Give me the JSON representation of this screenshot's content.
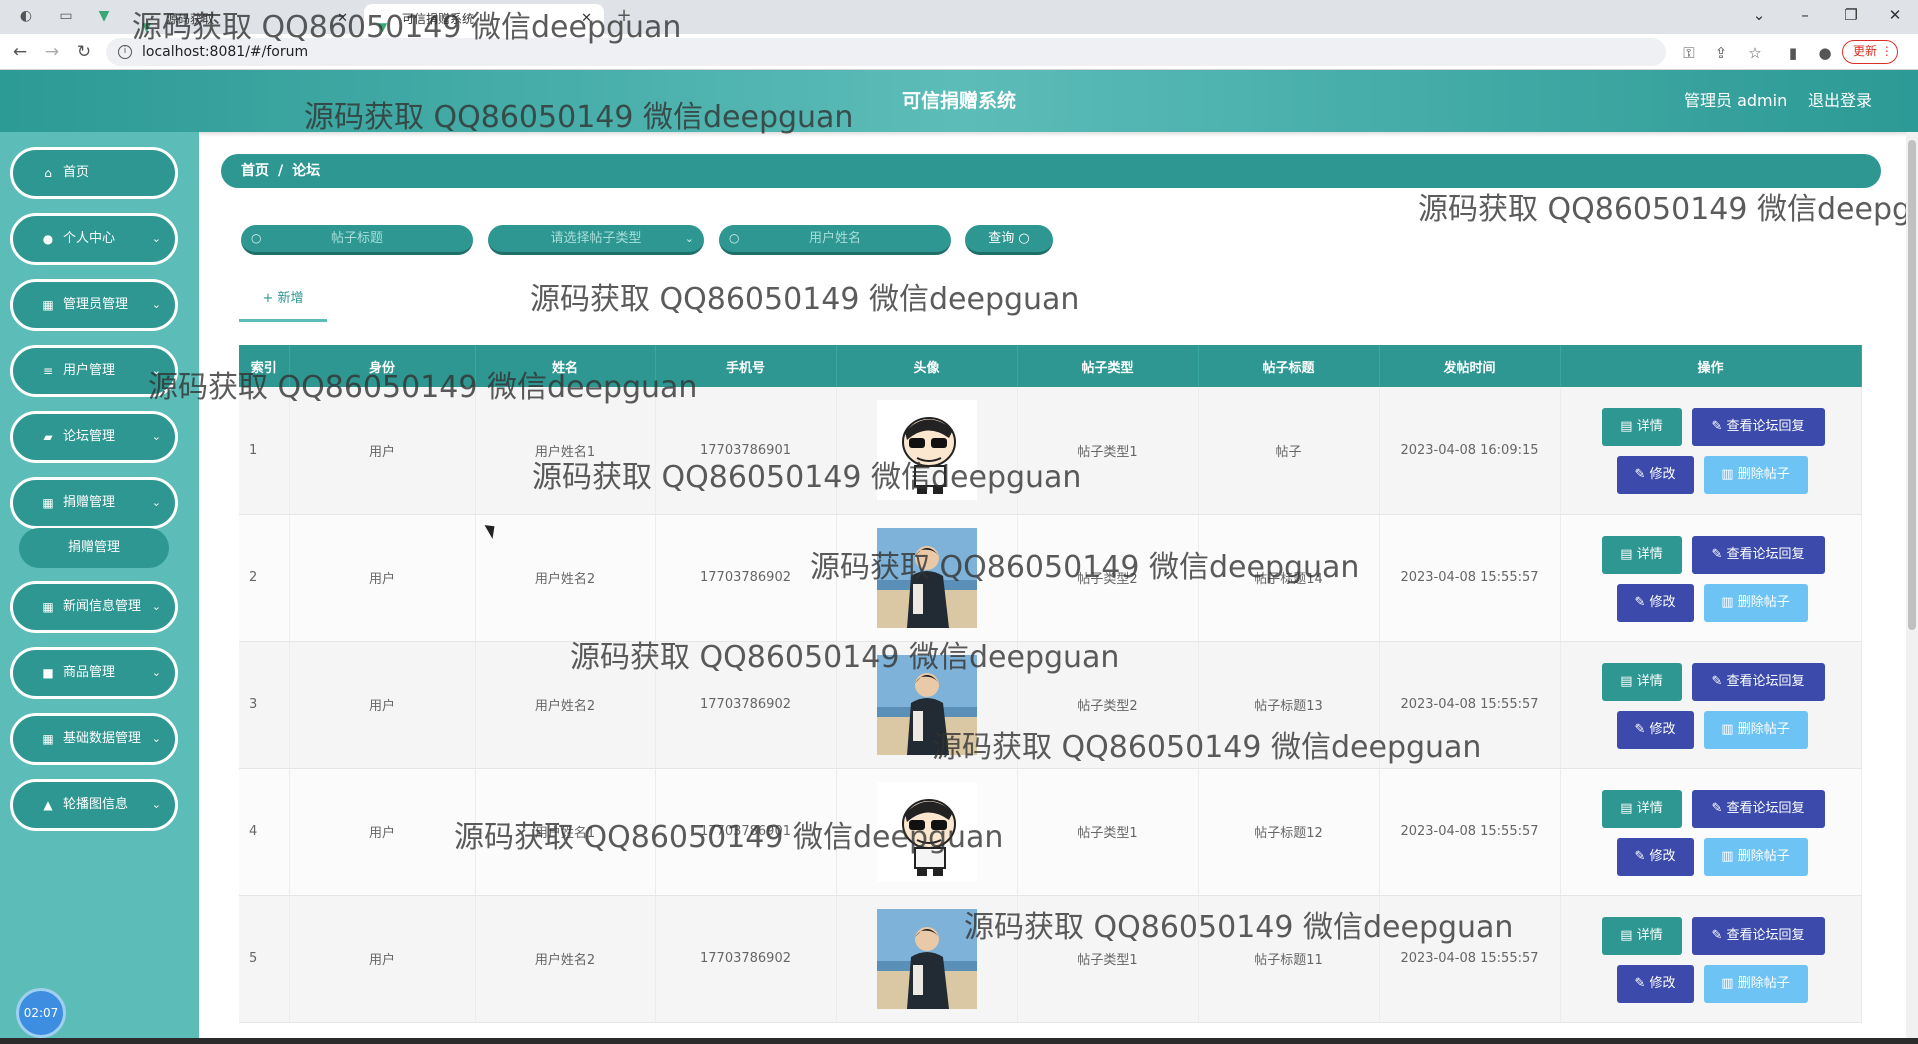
{
  "browser": {
    "tabs": [
      {
        "title": "源码获取"
      },
      {
        "title": "可信捐赠系统"
      }
    ],
    "url": "localhost:8081/#/forum",
    "update_label": "更新"
  },
  "header": {
    "title": "可信捐赠系统",
    "admin": "管理员 admin",
    "logout": "退出登录"
  },
  "sidebar": {
    "items": [
      {
        "label": "首页",
        "icon": "home-icon",
        "expandable": false
      },
      {
        "label": "个人中心",
        "icon": "user-icon",
        "expandable": true
      },
      {
        "label": "管理员管理",
        "icon": "grid-icon",
        "expandable": true
      },
      {
        "label": "用户管理",
        "icon": "list-icon",
        "expandable": true
      },
      {
        "label": "论坛管理",
        "icon": "chat-icon",
        "expandable": true
      },
      {
        "label": "捐赠管理",
        "icon": "grid-icon",
        "expandable": true
      },
      {
        "label": "新闻信息管理",
        "icon": "grid-icon",
        "expandable": true
      },
      {
        "label": "商品管理",
        "icon": "bag-icon",
        "expandable": true
      },
      {
        "label": "基础数据管理",
        "icon": "grid-icon",
        "expandable": true
      },
      {
        "label": "轮播图信息",
        "icon": "person-icon",
        "expandable": true
      }
    ],
    "sub_item": "捐赠管理",
    "clock": "02:07"
  },
  "breadcrumb": {
    "home": "首页",
    "separator": "/",
    "current": "论坛"
  },
  "search": {
    "title_placeholder": "帖子标题",
    "type_placeholder": "请选择帖子类型",
    "user_placeholder": "用户姓名",
    "query_label": "查询"
  },
  "add_label": "+ 新增",
  "table": {
    "columns": [
      "索引",
      "身份",
      "姓名",
      "手机号",
      "头像",
      "帖子类型",
      "帖子标题",
      "发帖时间",
      "操作"
    ],
    "rows": [
      {
        "index": "1",
        "role": "用户",
        "name": "用户姓名1",
        "phone": "17703786901",
        "avatar": "cartoon",
        "type": "帖子类型1",
        "title": "帖子",
        "time": "2023-04-08 16:09:15"
      },
      {
        "index": "2",
        "role": "用户",
        "name": "用户姓名2",
        "phone": "17703786902",
        "avatar": "photo",
        "type": "帖子类型2",
        "title": "帖子标题14",
        "time": "2023-04-08 15:55:57"
      },
      {
        "index": "3",
        "role": "用户",
        "name": "用户姓名2",
        "phone": "17703786902",
        "avatar": "photo",
        "type": "帖子类型2",
        "title": "帖子标题13",
        "time": "2023-04-08 15:55:57"
      },
      {
        "index": "4",
        "role": "用户",
        "name": "用户姓名1",
        "phone": "17703786901",
        "avatar": "cartoon",
        "type": "帖子类型1",
        "title": "帖子标题12",
        "time": "2023-04-08 15:55:57"
      },
      {
        "index": "5",
        "role": "用户",
        "name": "用户姓名2",
        "phone": "17703786902",
        "avatar": "photo",
        "type": "帖子类型1",
        "title": "帖子标题11",
        "time": "2023-04-08 15:55:57"
      }
    ],
    "actions": {
      "detail": "详情",
      "reply": "查看论坛回复",
      "edit": "修改",
      "delete": "删除帖子"
    }
  },
  "watermark": "源码获取 QQ86050149 微信deepguan",
  "colors": {
    "primary": "#2e9792",
    "sidebar": "#5cbcb8",
    "action_blue": "#3c4bab",
    "light_blue": "#6ec3f5"
  }
}
